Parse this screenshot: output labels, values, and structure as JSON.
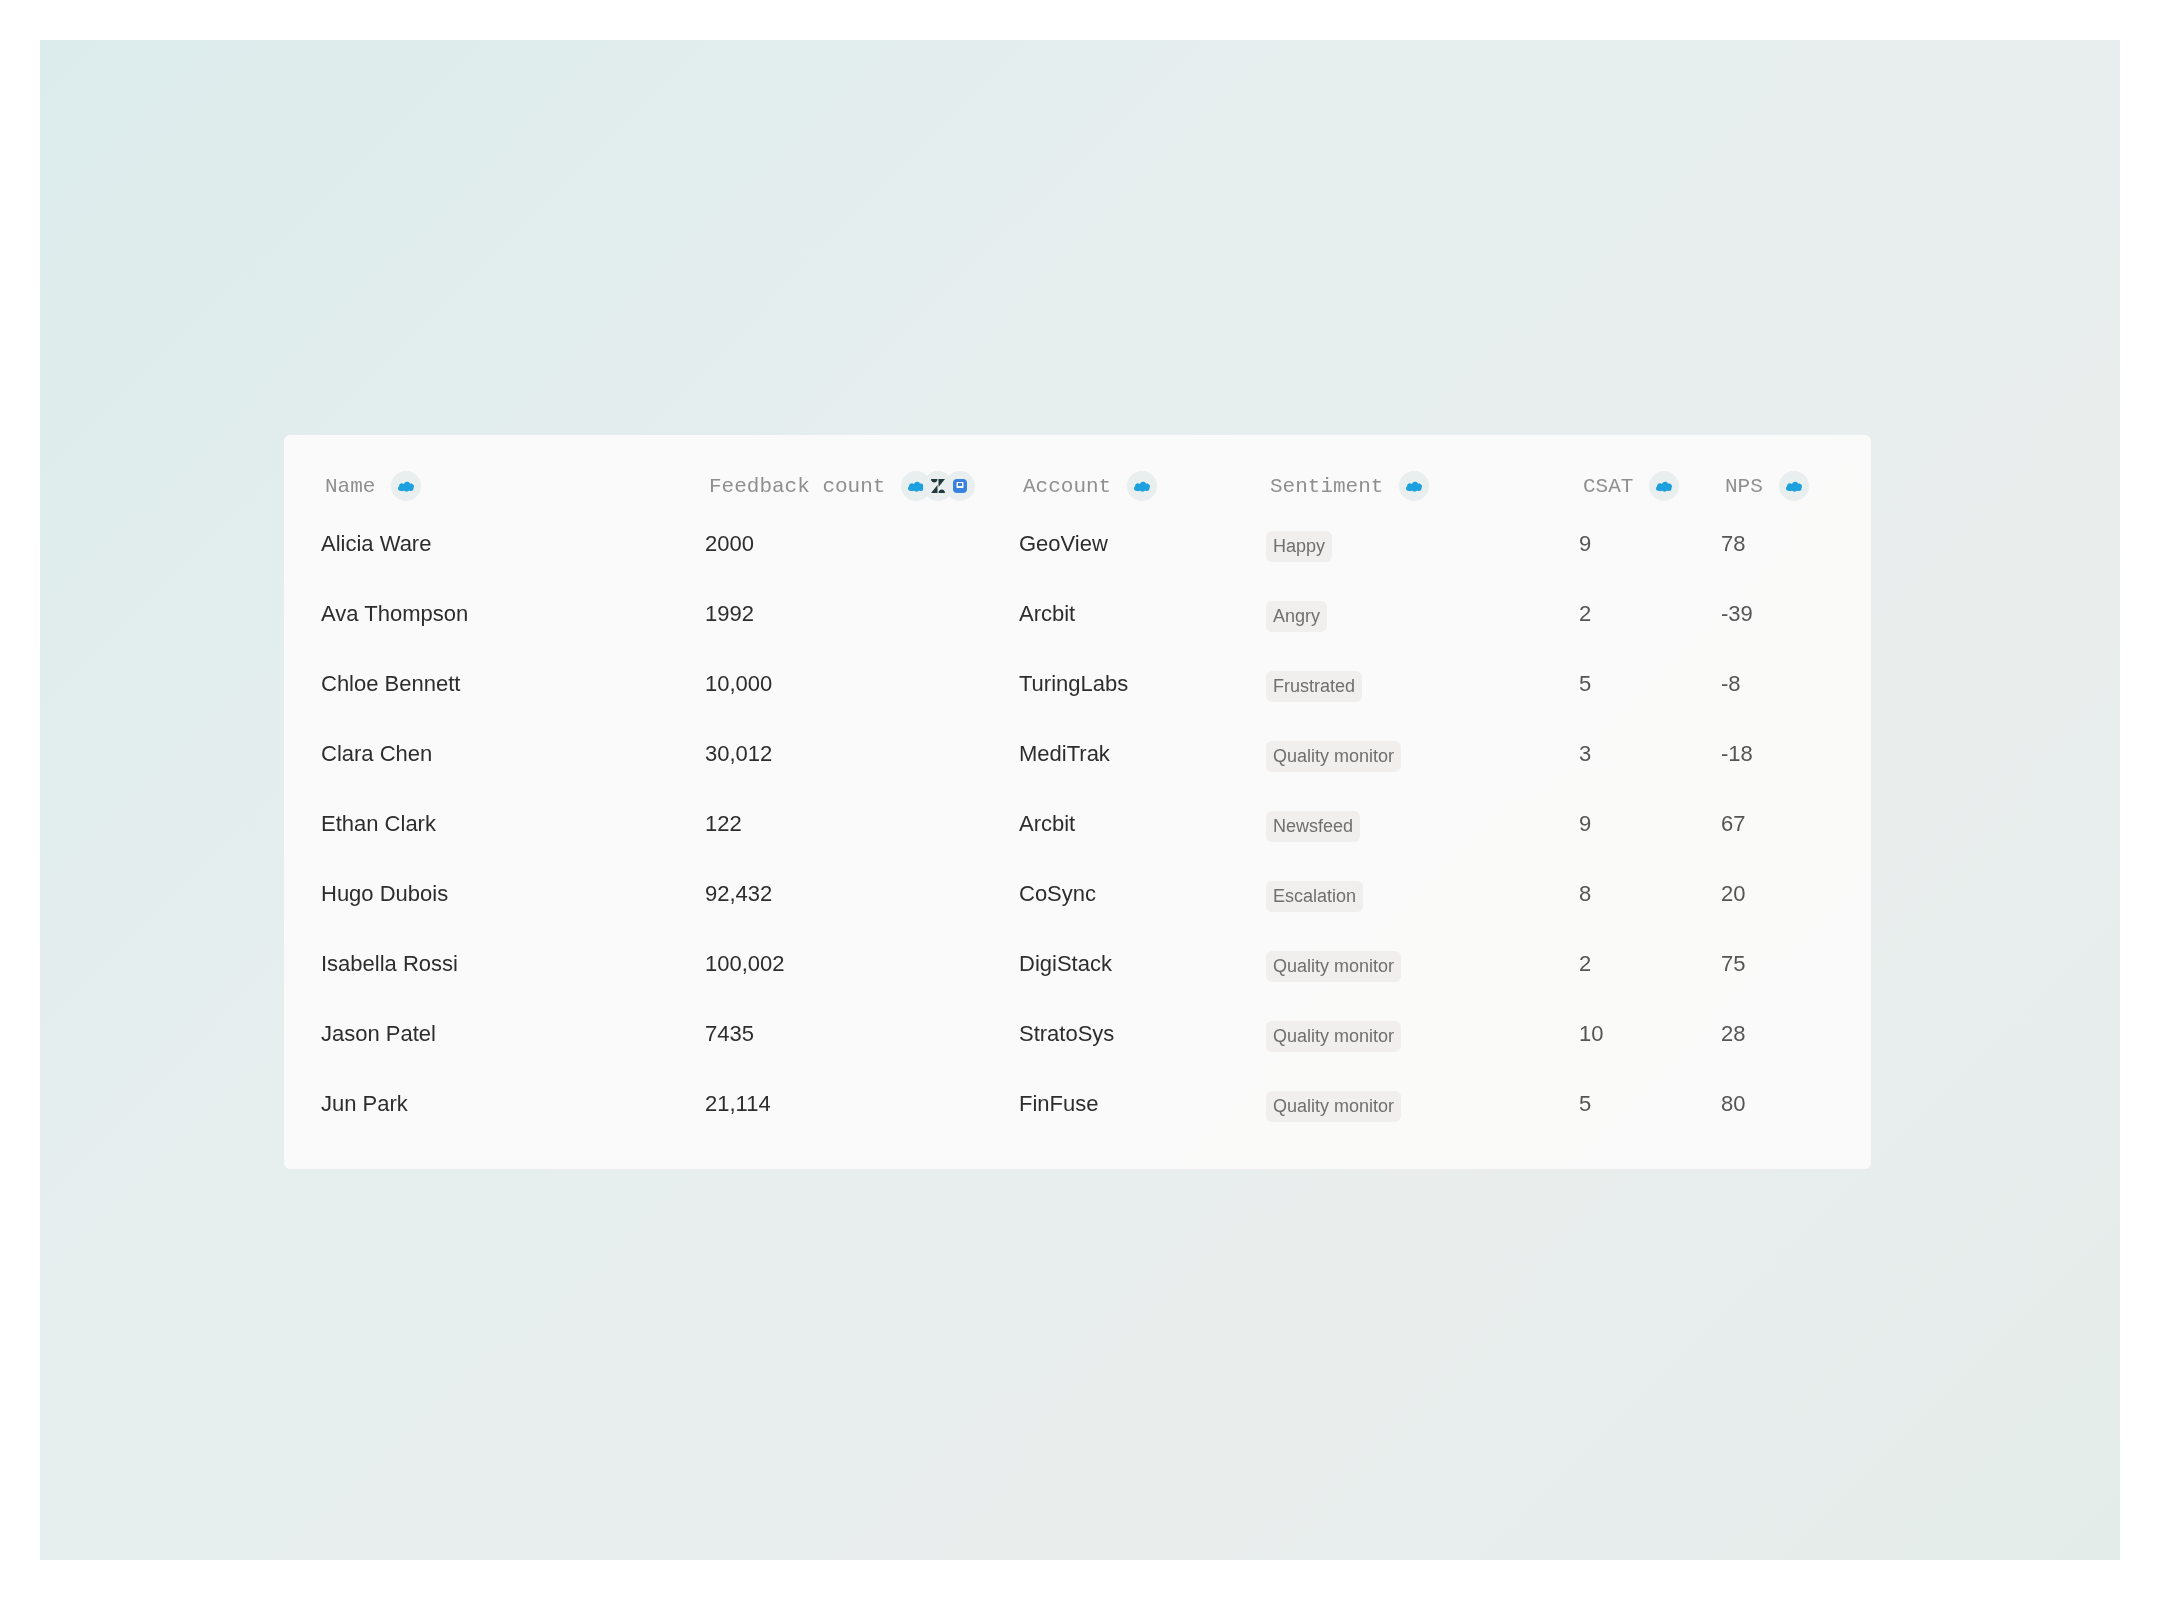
{
  "table": {
    "columns": [
      {
        "label": "Name",
        "sources": [
          {
            "kind": "cloud"
          }
        ]
      },
      {
        "label": "Feedback count",
        "sources": [
          {
            "kind": "cloud"
          },
          {
            "kind": "zed"
          },
          {
            "kind": "square"
          }
        ]
      },
      {
        "label": "Account",
        "sources": [
          {
            "kind": "cloud"
          }
        ]
      },
      {
        "label": "Sentiment",
        "sources": [
          {
            "kind": "cloud"
          }
        ]
      },
      {
        "label": "CSAT",
        "sources": [
          {
            "kind": "cloud"
          }
        ]
      },
      {
        "label": "NPS",
        "sources": [
          {
            "kind": "cloud"
          }
        ]
      }
    ],
    "rows": [
      {
        "name": "Alicia Ware",
        "feedback_count": "2000",
        "account": "GeoView",
        "sentiment": "Happy",
        "csat": "9",
        "nps": "78"
      },
      {
        "name": "Ava Thompson",
        "feedback_count": "1992",
        "account": "Arcbit",
        "sentiment": "Angry",
        "csat": "2",
        "nps": "-39"
      },
      {
        "name": "Chloe Bennett",
        "feedback_count": "10,000",
        "account": "TuringLabs",
        "sentiment": "Frustrated",
        "csat": "5",
        "nps": "-8"
      },
      {
        "name": "Clara Chen",
        "feedback_count": "30,012",
        "account": "MediTrak",
        "sentiment": "Quality monitor",
        "csat": "3",
        "nps": "-18"
      },
      {
        "name": "Ethan Clark",
        "feedback_count": "122",
        "account": "Arcbit",
        "sentiment": "Newsfeed",
        "csat": "9",
        "nps": "67"
      },
      {
        "name": "Hugo Dubois",
        "feedback_count": "92,432",
        "account": "CoSync",
        "sentiment": "Escalation",
        "csat": "8",
        "nps": "20"
      },
      {
        "name": "Isabella Rossi",
        "feedback_count": "100,002",
        "account": "DigiStack",
        "sentiment": "Quality monitor",
        "csat": "2",
        "nps": "75"
      },
      {
        "name": "Jason Patel",
        "feedback_count": "7435",
        "account": "StratoSys",
        "sentiment": "Quality monitor",
        "csat": "10",
        "nps": "28"
      },
      {
        "name": "Jun Park",
        "feedback_count": "21,114",
        "account": "FinFuse",
        "sentiment": "Quality monitor",
        "csat": "5",
        "nps": "80"
      }
    ]
  }
}
